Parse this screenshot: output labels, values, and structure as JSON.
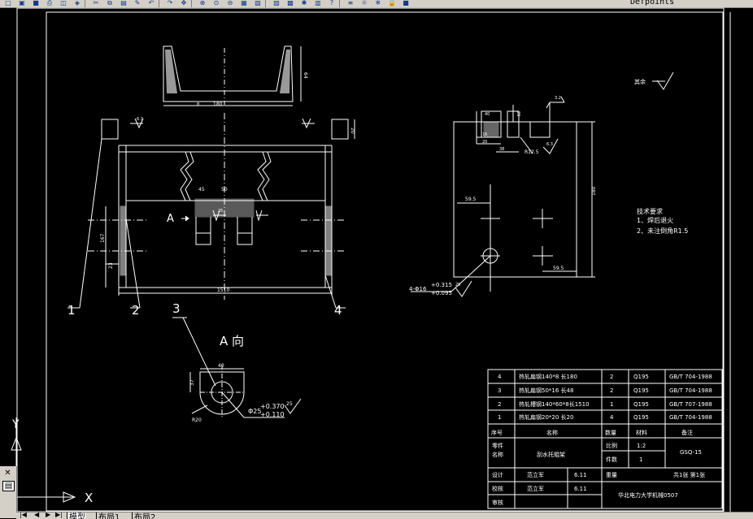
{
  "toolbar": {
    "layer_name": "Defpoints",
    "icons": [
      "new-icon",
      "open-icon",
      "save-icon",
      "print-icon",
      "preview-icon",
      "publish-icon",
      "cut-icon",
      "copy-icon",
      "paste-icon",
      "match-icon",
      "undo-icon",
      "redo-icon",
      "pan-icon",
      "zoom-realtime-icon",
      "zoom-window-icon",
      "zoom-previous-icon",
      "properties-icon",
      "design-center-icon",
      "tool-palette-icon",
      "sheet-set-icon",
      "markup-icon",
      "calculator-icon",
      "help-icon",
      "layer-manager-icon",
      "layer-visible-icon",
      "layer-freeze-icon",
      "layer-lock-icon",
      "layer-color-icon"
    ]
  },
  "tabs": {
    "items": [
      "模型",
      "布局1",
      "布局2"
    ],
    "active": 0
  },
  "ucs": {
    "x_label": "X",
    "y_label": "Y"
  },
  "drawing": {
    "colors": {
      "line": "#ffffff",
      "background": "#000000"
    },
    "roughness_label": "其余",
    "front_labels": {
      "view_a": "A",
      "dim_top_width": "180",
      "dim_top_height": "64",
      "dim_top_thick": "8",
      "dim_right_height": "20",
      "dim_overall_width": "1510",
      "dim_left_167": "167",
      "dim_left_23": "23",
      "dim_center_45": "45",
      "dim_center_50": "50",
      "parts": [
        "1",
        "2",
        "3",
        "4"
      ],
      "roughness_top": "6.3",
      "roughness_center": "25"
    },
    "side_labels": {
      "dim_top_w": "40",
      "dim_top_h": "20",
      "dim_20": "20",
      "dim_16": "16",
      "dim_38": "38",
      "dim_r": "R12.5",
      "dim_6": "6.3",
      "dim_3": "3.2",
      "dim_left": "59.5",
      "dim_height": "180",
      "dim_bottom": "59.5",
      "hole_spec": "4-Φ16",
      "tol_upper": "+0.315",
      "tol_lower": "+0.095",
      "roughness": "25"
    },
    "a_view": {
      "title": "A 向",
      "dim_width": "40",
      "dim_height": "37",
      "radius": "R20",
      "bore": "Φ25",
      "tol_upper": "+0.370",
      "tol_lower": "+0.110",
      "roughness": "25"
    },
    "tech_req": {
      "title": "技术要求",
      "lines": [
        "1、焊后退火",
        "2、未注倒角R1.5"
      ]
    }
  },
  "title_block": {
    "parts": [
      {
        "no": "4",
        "name": "热轧扁钢140*8 长180",
        "qty": "2",
        "material": "Q195",
        "std": "GB/T 704-1988"
      },
      {
        "no": "3",
        "name": "热轧扁钢50*16 长48",
        "qty": "2",
        "material": "Q195",
        "std": "GB/T 704-1988"
      },
      {
        "no": "2",
        "name": "热轧槽钢140*60*8长1510",
        "qty": "1",
        "material": "Q195",
        "std": "GB/T 707-1988"
      },
      {
        "no": "1",
        "name": "热轧扁钢20*20 长20",
        "qty": "4",
        "material": "Q195",
        "std": "GB/T 704-1988"
      }
    ],
    "header": {
      "no": "序号",
      "name": "名称",
      "qty": "数量",
      "material": "材料",
      "note": "备注"
    },
    "part_name_label": "零件\n名称",
    "part_name_label_1": "零件",
    "part_name_label_2": "名称",
    "part_name": "刮水托辊架",
    "scale_label": "比例",
    "scale": "1:2",
    "count_label": "件数",
    "count": "1",
    "code": "GSQ-15",
    "weight_label": "重量",
    "sheets": "共1张 第1张",
    "design_label": "设计",
    "check_label": "校核",
    "review_label": "审核",
    "designer": "范立军",
    "checker": "范立军",
    "design_date": "6.11",
    "check_date": "6.11",
    "school": "华北电力大学机械0507"
  }
}
